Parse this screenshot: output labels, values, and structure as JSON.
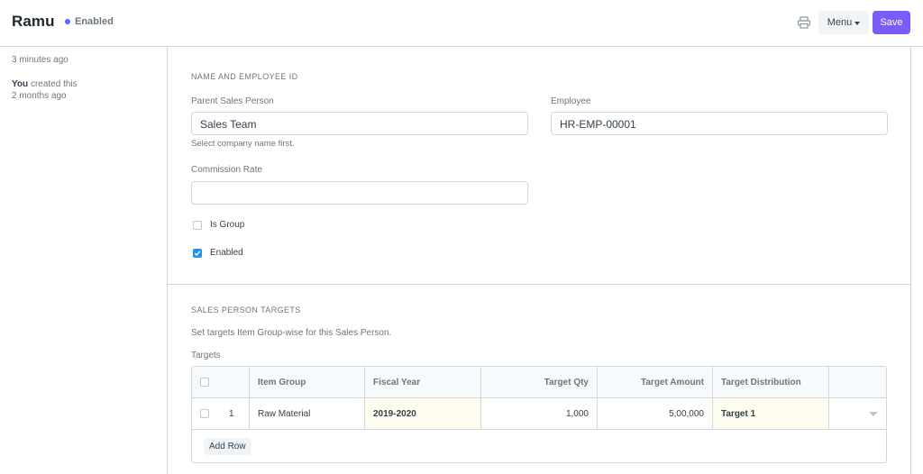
{
  "header": {
    "title": "Ramu",
    "status": "Enabled",
    "menu_label": "Menu",
    "save_label": "Save",
    "accent_color": "#7b5cfa",
    "status_color": "#5e64ff"
  },
  "sidebar": {
    "modified": "3 minutes ago",
    "creator": "You",
    "created_text": "created this",
    "created_when": "2 months ago"
  },
  "section1": {
    "heading": "NAME AND EMPLOYEE ID",
    "parent_label": "Parent Sales Person",
    "parent_value": "Sales Team",
    "parent_help": "Select company name first.",
    "employee_label": "Employee",
    "employee_value": "HR-EMP-00001",
    "commission_label": "Commission Rate",
    "commission_value": "",
    "is_group_label": "Is Group",
    "is_group_checked": false,
    "enabled_label": "Enabled",
    "enabled_checked": true
  },
  "section2": {
    "heading": "SALES PERSON TARGETS",
    "description": "Set targets Item Group-wise for this Sales Person.",
    "table_label": "Targets",
    "columns": [
      "Item Group",
      "Fiscal Year",
      "Target Qty",
      "Target Amount",
      "Target Distribution"
    ],
    "rows": [
      {
        "idx": "1",
        "item_group": "Raw Material",
        "fiscal_year": "2019-2020",
        "target_qty": "1,000",
        "target_amount": "5,00,000",
        "target_distribution": "Target 1"
      }
    ],
    "add_row_label": "Add Row"
  }
}
